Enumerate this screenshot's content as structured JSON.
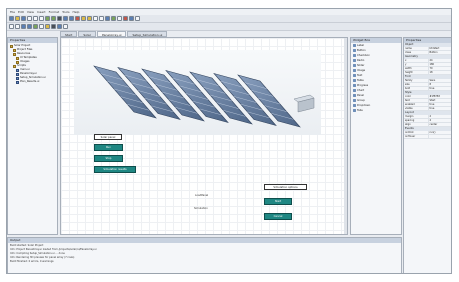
{
  "menubar": [
    "File",
    "Edit",
    "View",
    "Insert",
    "Format",
    "Tools",
    "Help"
  ],
  "tabs": [
    {
      "label": "Start"
    },
    {
      "label": "Solar"
    },
    {
      "label": "PanelArray.ui"
    },
    {
      "label": "Setup_Simulation.ui"
    }
  ],
  "project": {
    "title": "Properties",
    "items": [
      {
        "label": "Solar Project",
        "indent": 0,
        "icon": "folder-icon"
      },
      {
        "label": "Project Files",
        "indent": 1,
        "icon": "folder-icon"
      },
      {
        "label": "Resources",
        "indent": 1,
        "icon": "folder-icon"
      },
      {
        "label": "UI Templates",
        "indent": 2,
        "icon": "folder-icon"
      },
      {
        "label": "Images",
        "indent": 2,
        "icon": "folder-icon"
      },
      {
        "label": "Scripts",
        "indent": 1,
        "icon": "folder-icon"
      },
      {
        "label": "main.ui",
        "indent": 2,
        "icon": "file-icon"
      },
      {
        "label": "PanelArray.ui",
        "indent": 2,
        "icon": "file-icon"
      },
      {
        "label": "Setup_Simulation.ui",
        "indent": 2,
        "icon": "file-icon"
      },
      {
        "label": "Plan_Results.ui",
        "indent": 2,
        "icon": "file-icon"
      }
    ]
  },
  "canvas": {
    "label_box": "Solar panel",
    "buttons": [
      "Run",
      "Stop",
      "Simulation results"
    ],
    "center_text_1": "LoadPanel",
    "center_text_2": "Simulation",
    "right_label": "Simulation options",
    "right_buttons": [
      "Start",
      "Cancel"
    ]
  },
  "palette": {
    "title": "Widget Box",
    "items": [
      "Label",
      "Button",
      "Checkbox",
      "Radio",
      "Slider",
      "Image",
      "Text",
      "Table",
      "Progress",
      "Chart",
      "Panel",
      "Group",
      "Dropdown",
      "Tabs"
    ]
  },
  "properties": {
    "title": "Properties",
    "sections": [
      {
        "head": "Object",
        "rows": [
          [
            "name",
            "btnStart"
          ],
          [
            "class",
            "Button"
          ]
        ]
      },
      {
        "head": "Geometry",
        "rows": [
          [
            "x",
            "24"
          ],
          [
            "y",
            "180"
          ],
          [
            "width",
            "70"
          ],
          [
            "height",
            "18"
          ]
        ]
      },
      {
        "head": "Font",
        "rows": [
          [
            "family",
            "Sans"
          ],
          [
            "size",
            "8"
          ],
          [
            "bold",
            "true"
          ]
        ]
      },
      {
        "head": "Style",
        "rows": [
          [
            "color",
            "#1f8783"
          ],
          [
            "text",
            "Start"
          ],
          [
            "enabled",
            "true"
          ],
          [
            "visible",
            "true"
          ]
        ]
      },
      {
        "head": "Layout",
        "rows": [
          [
            "margin",
            "2"
          ],
          [
            "spacing",
            "4"
          ],
          [
            "align",
            "center"
          ]
        ]
      },
      {
        "head": "Events",
        "rows": [
          [
            "onClick",
            "run()"
          ],
          [
            "onHover",
            ""
          ]
        ]
      }
    ]
  },
  "console": {
    "title": "Output",
    "lines": [
      "Build started: Solar Project",
      "Info: Project PanelArray.ui loaded from /projects/solar/ui/PanelArray.ui",
      "Info: Compiling Setup_Simulation.ui ... done",
      "Info: Rendering 3D preview for panel array (7 rows)",
      "Build finished: 0 errors, 0 warnings"
    ]
  },
  "colors": {
    "accent": "#1f8783",
    "panel_title": "#c7d1df"
  }
}
